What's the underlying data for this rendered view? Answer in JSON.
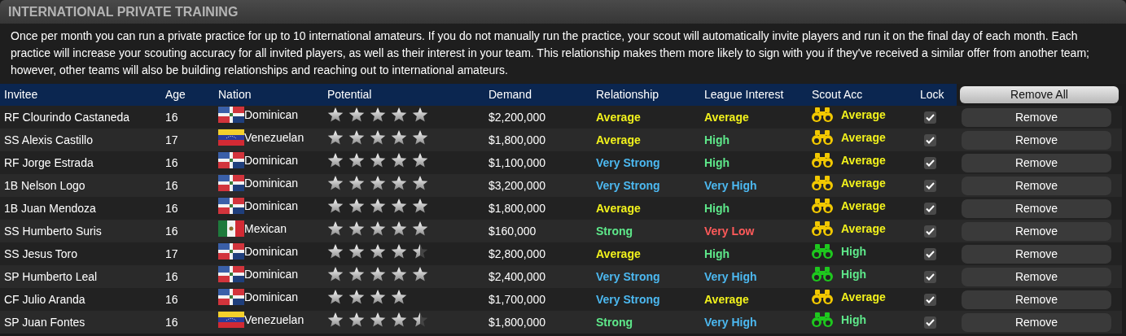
{
  "panel": {
    "title": "INTERNATIONAL PRIVATE TRAINING",
    "description": "Once per month you can run a private practice for up to 10 international amateurs. If you do not manually run the practice, your scout will automatically invite players and run it on the final day of each month. Each practice will increase your scouting accuracy for all invited players, as well as their interest in your team. This relationship makes them more likely to sign with you if they've received a similar offer from another team; however, other teams will also be building relationships and reaching out to international amateurs."
  },
  "table": {
    "columns": [
      "Invitee",
      "Age",
      "Nation",
      "Potential",
      "Demand",
      "Relationship",
      "League Interest",
      "Scout Acc",
      "Lock"
    ],
    "remove_all": "Remove All",
    "rows": [
      {
        "invitee": "RF Clourindo Castaneda",
        "age": "16",
        "nation": {
          "kind": "dominican",
          "text": "Dominican"
        },
        "stars": 5,
        "demand": "$2,200,000",
        "relationship": {
          "text": "Average",
          "color": "#f2f21c"
        },
        "league_interest": {
          "text": "Average",
          "color": "#f2f21c"
        },
        "scout": {
          "icon": {
            "color": "#f2c800"
          },
          "text": "Average",
          "color": "#f2f21c"
        },
        "locked": true,
        "button": "Remove"
      },
      {
        "invitee": "SS Alexis Castillo",
        "age": "17",
        "nation": {
          "kind": "venezuelan",
          "text": "Venezuelan"
        },
        "stars": 5,
        "demand": "$1,800,000",
        "relationship": {
          "text": "Average",
          "color": "#f2f21c"
        },
        "league_interest": {
          "text": "High",
          "color": "#5ee88a"
        },
        "scout": {
          "icon": {
            "color": "#f2c800"
          },
          "text": "Average",
          "color": "#f2f21c"
        },
        "locked": true,
        "button": "Remove"
      },
      {
        "invitee": "RF Jorge Estrada",
        "age": "16",
        "nation": {
          "kind": "dominican",
          "text": "Dominican"
        },
        "stars": 5,
        "demand": "$1,100,000",
        "relationship": {
          "text": "Very Strong",
          "color": "#4cb8f0"
        },
        "league_interest": {
          "text": "High",
          "color": "#5ee88a"
        },
        "scout": {
          "icon": {
            "color": "#f2c800"
          },
          "text": "Average",
          "color": "#f2f21c"
        },
        "locked": true,
        "button": "Remove"
      },
      {
        "invitee": "1B Nelson Logo",
        "age": "16",
        "nation": {
          "kind": "dominican",
          "text": "Dominican"
        },
        "stars": 5,
        "demand": "$3,200,000",
        "relationship": {
          "text": "Very Strong",
          "color": "#4cb8f0"
        },
        "league_interest": {
          "text": "Very High",
          "color": "#4cb8f0"
        },
        "scout": {
          "icon": {
            "color": "#f2c800"
          },
          "text": "Average",
          "color": "#f2f21c"
        },
        "locked": true,
        "button": "Remove"
      },
      {
        "invitee": "1B Juan Mendoza",
        "age": "16",
        "nation": {
          "kind": "dominican",
          "text": "Dominican"
        },
        "stars": 5,
        "demand": "$1,800,000",
        "relationship": {
          "text": "Average",
          "color": "#f2f21c"
        },
        "league_interest": {
          "text": "High",
          "color": "#5ee88a"
        },
        "scout": {
          "icon": {
            "color": "#f2c800"
          },
          "text": "Average",
          "color": "#f2f21c"
        },
        "locked": true,
        "button": "Remove"
      },
      {
        "invitee": "SS Humberto Suris",
        "age": "16",
        "nation": {
          "kind": "mexican",
          "text": "Mexican"
        },
        "stars": 5,
        "demand": "$160,000",
        "relationship": {
          "text": "Strong",
          "color": "#5ee88a"
        },
        "league_interest": {
          "text": "Very Low",
          "color": "#ff5a5a"
        },
        "scout": {
          "icon": {
            "color": "#f2c800"
          },
          "text": "Average",
          "color": "#f2f21c"
        },
        "locked": true,
        "button": "Remove"
      },
      {
        "invitee": "SS Jesus Toro",
        "age": "17",
        "nation": {
          "kind": "dominican",
          "text": "Dominican"
        },
        "stars": 4.5,
        "demand": "$2,800,000",
        "relationship": {
          "text": "Average",
          "color": "#f2f21c"
        },
        "league_interest": {
          "text": "High",
          "color": "#5ee88a"
        },
        "scout": {
          "icon": {
            "color": "#1ec81e"
          },
          "text": "High",
          "color": "#5ee88a"
        },
        "locked": true,
        "button": "Remove"
      },
      {
        "invitee": "SP Humberto Leal",
        "age": "16",
        "nation": {
          "kind": "dominican",
          "text": "Dominican"
        },
        "stars": 5,
        "demand": "$2,400,000",
        "relationship": {
          "text": "Very Strong",
          "color": "#4cb8f0"
        },
        "league_interest": {
          "text": "Very High",
          "color": "#4cb8f0"
        },
        "scout": {
          "icon": {
            "color": "#1ec81e"
          },
          "text": "High",
          "color": "#5ee88a"
        },
        "locked": true,
        "button": "Remove"
      },
      {
        "invitee": "CF Julio Aranda",
        "age": "16",
        "nation": {
          "kind": "dominican",
          "text": "Dominican"
        },
        "stars": 4,
        "demand": "$1,700,000",
        "relationship": {
          "text": "Very Strong",
          "color": "#4cb8f0"
        },
        "league_interest": {
          "text": "Average",
          "color": "#f2f21c"
        },
        "scout": {
          "icon": {
            "color": "#f2c800"
          },
          "text": "Average",
          "color": "#f2f21c"
        },
        "locked": true,
        "button": "Remove"
      },
      {
        "invitee": "SP Juan Fontes",
        "age": "16",
        "nation": {
          "kind": "venezuelan",
          "text": "Venezuelan"
        },
        "stars": 4.5,
        "demand": "$1,800,000",
        "relationship": {
          "text": "Strong",
          "color": "#5ee88a"
        },
        "league_interest": {
          "text": "Very High",
          "color": "#4cb8f0"
        },
        "scout": {
          "icon": {
            "color": "#1ec81e"
          },
          "text": "High",
          "color": "#5ee88a"
        },
        "locked": true,
        "button": "Remove"
      }
    ]
  }
}
